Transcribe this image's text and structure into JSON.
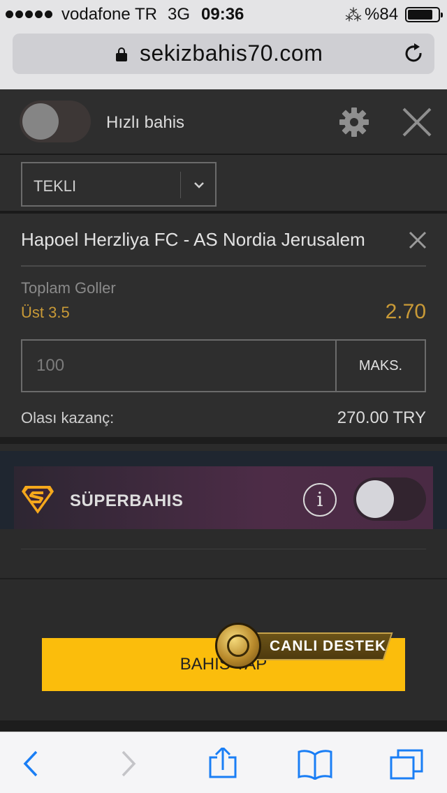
{
  "status_bar": {
    "carrier": "vodafone TR",
    "network": "3G",
    "time": "09:36",
    "battery": "%84",
    "battery_level": 0.84
  },
  "browser": {
    "url": "sekizbahis70.com"
  },
  "header": {
    "quick_bet_label": "Hızlı bahis",
    "quick_bet_on": false
  },
  "bet_type": {
    "selected": "TEKLI"
  },
  "bet": {
    "match": "Hapoel Herzliya FC - AS Nordia Jerusalem",
    "market": "Toplam Goller",
    "selection": "Üst 3.5",
    "odds": "2.70",
    "stake_placeholder": "100",
    "max_label": "MAKS.",
    "potential_win_label": "Olası kazanç:",
    "potential_win_value": "270.00 TRY"
  },
  "super_bet": {
    "label": "SÜPERBAHIS",
    "info_glyph": "i",
    "enabled": false,
    "icon": "superbahis-s-logo"
  },
  "place_bet_label": "BAHIS YAP",
  "support_label": "CANLI DESTEK",
  "colors": {
    "accent_gold": "#c99a37",
    "button_yellow": "#fbbd0c",
    "ios_blue": "#1a7ef5"
  }
}
